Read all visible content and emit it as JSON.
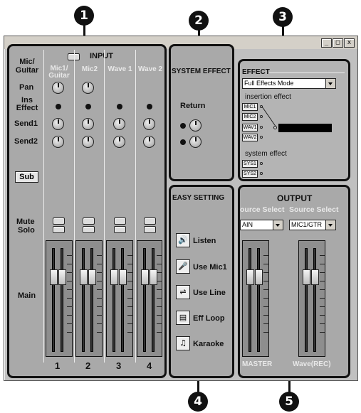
{
  "callouts": [
    "1",
    "2",
    "3",
    "4",
    "5"
  ],
  "window": {
    "buttons": [
      "_",
      "□",
      "x"
    ]
  },
  "input": {
    "title": "INPUT",
    "row_labels": {
      "mic_guitar": "Mic/\nGuitar",
      "pan": "Pan",
      "ins_effect": "Ins\nEffect",
      "send1": "Send1",
      "send2": "Send2",
      "mute": "Mute",
      "solo": "Solo",
      "main": "Main"
    },
    "sub_button": "Sub",
    "channel_names": [
      "Mic1/\nGuitar",
      "Mic2",
      "Wave 1",
      "Wave 2"
    ],
    "channel_numbers": [
      "1",
      "2",
      "3",
      "4"
    ]
  },
  "system_effect": {
    "title": "SYSTEM EFFECT",
    "return_label": "Return"
  },
  "effect": {
    "title": "EFFECT",
    "mode_value": "Full Effects Mode",
    "insertion_label": "insertion effect",
    "insertion_sources": [
      "MIC1",
      "MIC2",
      "WAV1",
      "WAV2"
    ],
    "system_label": "system effect",
    "system_sources": [
      "SYS1",
      "SYS2"
    ]
  },
  "easy_setting": {
    "title": "EASY SETTING",
    "items": [
      {
        "label": "Listen",
        "icon": "speaker-icon"
      },
      {
        "label": "Use Mic1",
        "icon": "microphone-icon"
      },
      {
        "label": "Use Line",
        "icon": "line-cable-icon"
      },
      {
        "label": "Eff Loop",
        "icon": "effect-loop-icon"
      },
      {
        "label": "Karaoke",
        "icon": "karaoke-icon"
      }
    ]
  },
  "output": {
    "title": "OUTPUT",
    "source_select_labels": [
      "ource Select",
      "Source Select"
    ],
    "source_values": [
      "AIN",
      "MIC1/GTR"
    ],
    "fader_labels": [
      "MASTER",
      "Wave(REC)"
    ]
  },
  "colors": {
    "panel": "#a9a9a9",
    "frame": "#111111",
    "window": "#c0c0c0"
  }
}
